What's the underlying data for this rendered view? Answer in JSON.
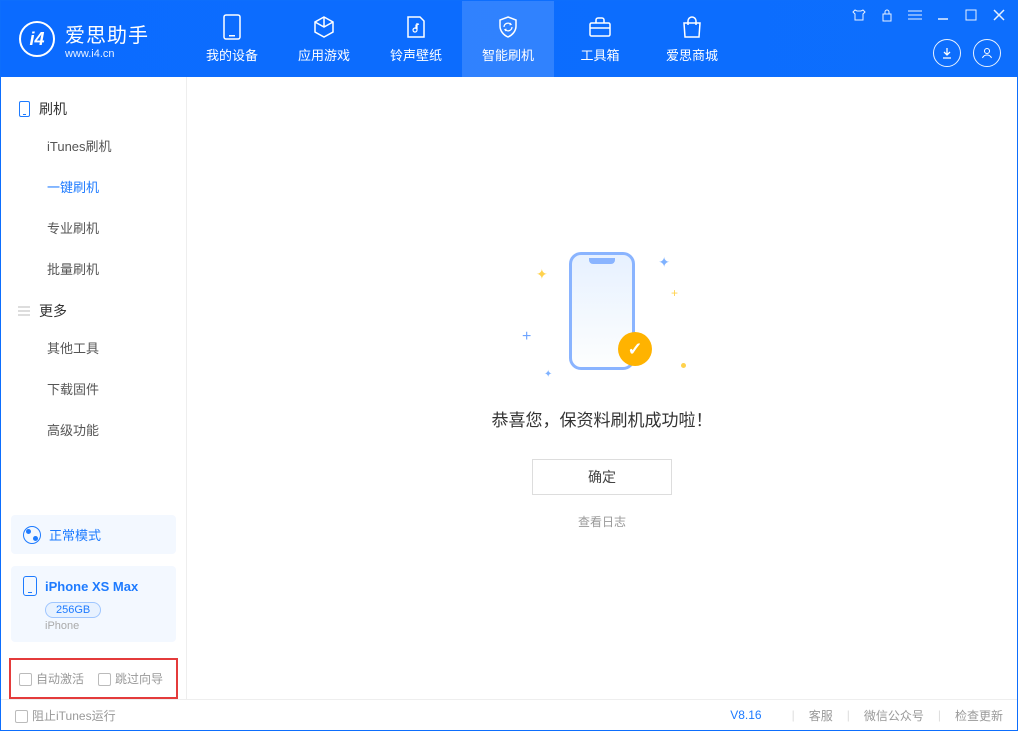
{
  "app": {
    "title": "爱思助手",
    "subtitle": "www.i4.cn"
  },
  "nav": {
    "tabs": [
      {
        "label": "我的设备"
      },
      {
        "label": "应用游戏"
      },
      {
        "label": "铃声壁纸"
      },
      {
        "label": "智能刷机"
      },
      {
        "label": "工具箱"
      },
      {
        "label": "爱思商城"
      }
    ]
  },
  "sidebar": {
    "sections": [
      {
        "title": "刷机",
        "items": [
          "iTunes刷机",
          "一键刷机",
          "专业刷机",
          "批量刷机"
        ]
      },
      {
        "title": "更多",
        "items": [
          "其他工具",
          "下载固件",
          "高级功能"
        ]
      }
    ],
    "mode": "正常模式",
    "device": {
      "name": "iPhone XS Max",
      "storage": "256GB",
      "type": "iPhone"
    },
    "checkboxes": {
      "auto_activate": "自动激活",
      "skip_guide": "跳过向导"
    }
  },
  "main": {
    "success_title": "恭喜您，保资料刷机成功啦！",
    "ok_button": "确定",
    "view_log": "查看日志"
  },
  "footer": {
    "block_itunes": "阻止iTunes运行",
    "version": "V8.16",
    "links": [
      "客服",
      "微信公众号",
      "检查更新"
    ]
  }
}
